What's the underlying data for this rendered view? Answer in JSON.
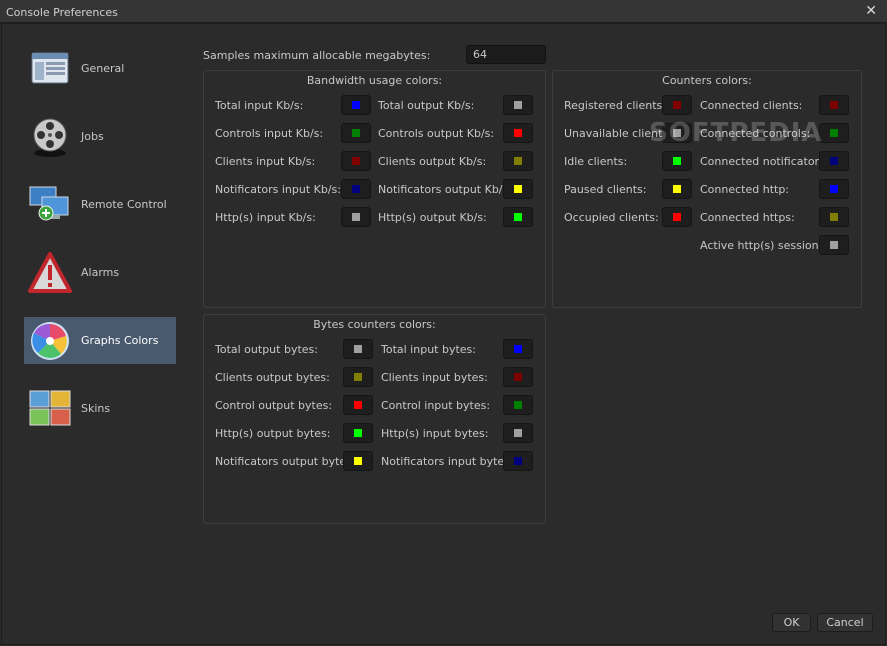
{
  "window": {
    "title": "Console Preferences",
    "close_glyph": "✕"
  },
  "sidebar": [
    {
      "label": "General",
      "icon": "general-window-icon"
    },
    {
      "label": "Jobs",
      "icon": "film-reel-icon"
    },
    {
      "label": "Remote Control",
      "icon": "remote-monitors-icon"
    },
    {
      "label": "Alarms",
      "icon": "warning-triangle-icon"
    },
    {
      "label": "Graphs Colors",
      "icon": "color-disc-icon",
      "selected": true
    },
    {
      "label": "Skins",
      "icon": "skins-icon"
    }
  ],
  "samples": {
    "label": "Samples maximum allocable megabytes:",
    "value": "64"
  },
  "bandwidth": {
    "title": "Bandwidth usage colors:",
    "rows": [
      {
        "left": "Total input Kb/s:",
        "left_color": "#0000ff",
        "right": "Total output Kb/s:",
        "right_color": "#a0a0a0"
      },
      {
        "left": "Controls input Kb/s:",
        "left_color": "#008000",
        "right": "Controls output Kb/s:",
        "right_color": "#ff0000"
      },
      {
        "left": "Clients input Kb/s:",
        "left_color": "#800000",
        "right": "Clients output Kb/s:",
        "right_color": "#808000"
      },
      {
        "left": "Notificators input Kb/s:",
        "left_color": "#000080",
        "right": "Notificators output Kb/s:",
        "right_color": "#ffff00"
      },
      {
        "left": "Http(s) input Kb/s:",
        "left_color": "#a0a0a0",
        "right": "Http(s) output Kb/s:",
        "right_color": "#00ff00"
      }
    ]
  },
  "counters": {
    "title": "Counters colors:",
    "rows": [
      {
        "left": "Registered clients",
        "left_color": "#800000",
        "right": "Connected clients:",
        "right_color": "#800000"
      },
      {
        "left": "Unavailable clients",
        "left_color": "#a0a0a0",
        "right": "Connected controls:",
        "right_color": "#008000"
      },
      {
        "left": "Idle clients:",
        "left_color": "#00ff00",
        "right": "Connected notificators:",
        "right_color": "#000080"
      },
      {
        "left": "Paused clients:",
        "left_color": "#ffff00",
        "right": "Connected http:",
        "right_color": "#0000ff"
      },
      {
        "left": "Occupied clients:",
        "left_color": "#ff0000",
        "right": "Connected https:",
        "right_color": "#808000"
      },
      {
        "left": "",
        "left_color": "",
        "right": "Active http(s) sessions:",
        "right_color": "#a0a0a0"
      }
    ]
  },
  "bytes": {
    "title": "Bytes counters colors:",
    "rows": [
      {
        "left": "Total output bytes:",
        "left_color": "#a0a0a0",
        "right": "Total input bytes:",
        "right_color": "#0000ff"
      },
      {
        "left": "Clients output bytes:",
        "left_color": "#808000",
        "right": "Clients input bytes:",
        "right_color": "#800000"
      },
      {
        "left": "Control output bytes:",
        "left_color": "#ff0000",
        "right": "Control input bytes:",
        "right_color": "#008000"
      },
      {
        "left": "Http(s) output bytes:",
        "left_color": "#00ff00",
        "right": "Http(s) input bytes:",
        "right_color": "#a0a0a0"
      },
      {
        "left": "Notificators output bytes:",
        "left_color": "#ffff00",
        "right": "Notificators input bytes:",
        "right_color": "#000080"
      }
    ]
  },
  "buttons": {
    "ok": "OK",
    "cancel": "Cancel"
  },
  "watermark": "SOFTPEDIA"
}
